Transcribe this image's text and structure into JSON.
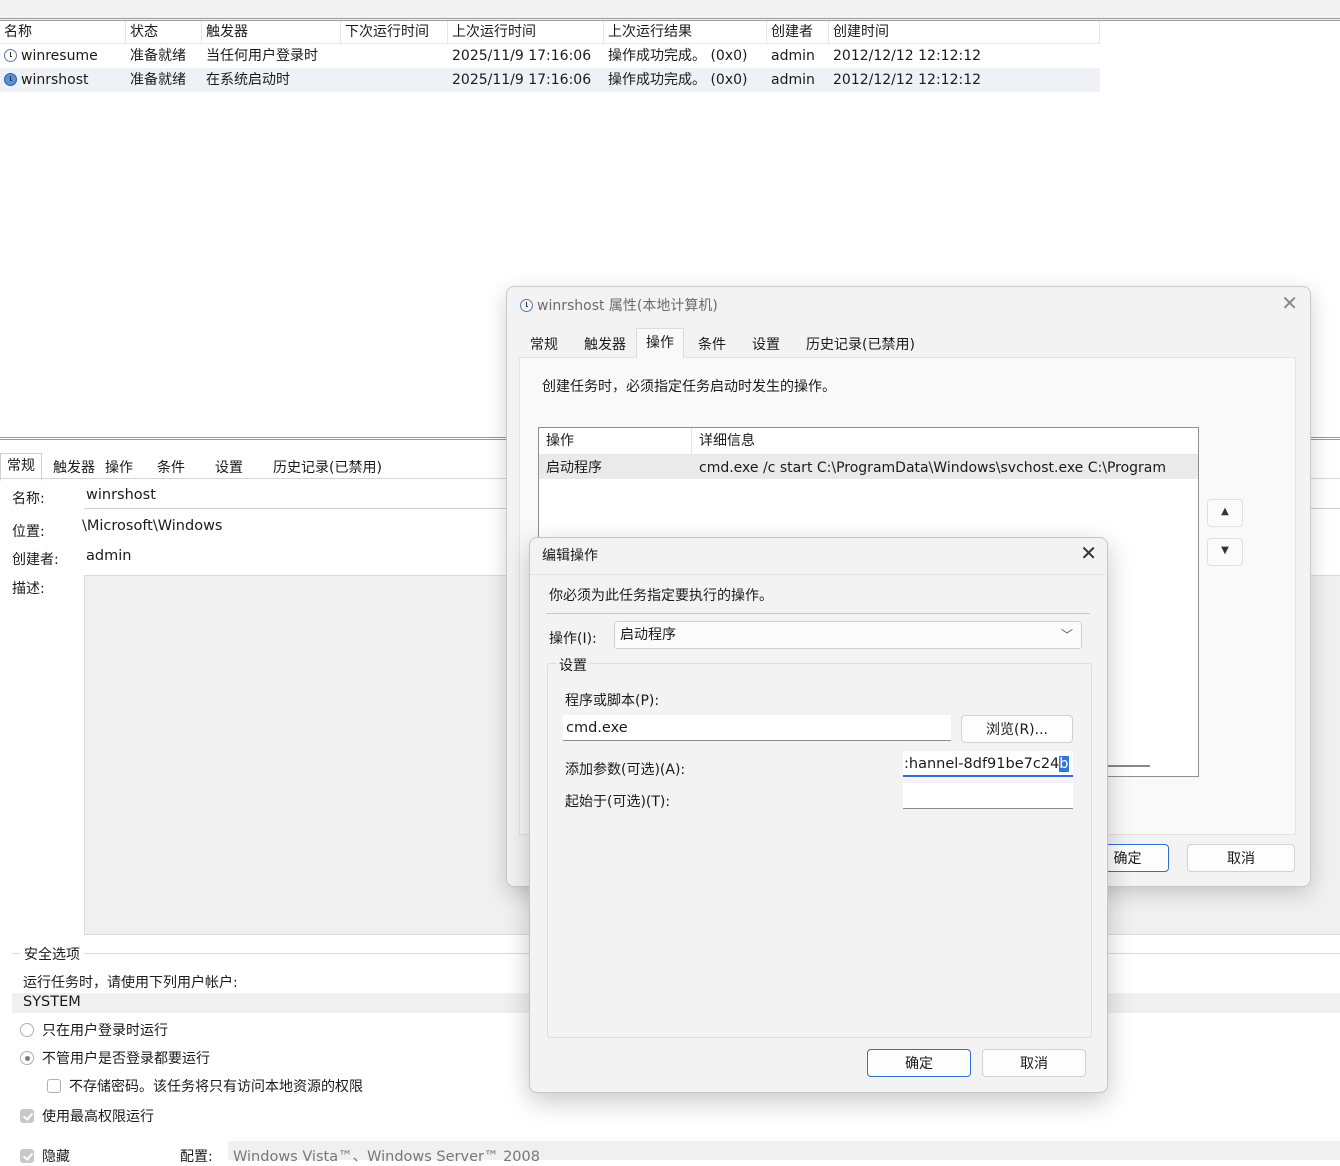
{
  "task_list": {
    "columns": [
      "名称",
      "状态",
      "触发器",
      "下次运行时间",
      "上次运行时间",
      "上次运行结果",
      "创建者",
      "创建时间"
    ],
    "rows": [
      {
        "name": "winresume",
        "status": "准备就绪",
        "trigger": "当任何用户登录时",
        "next_run": "",
        "last_run": "2025/11/9 17:16:06",
        "last_result": "操作成功完成。 (0x0)",
        "author": "admin",
        "created": "2012/12/12 12:12:12",
        "icon": "clock-icon"
      },
      {
        "name": "winrshost",
        "status": "准备就绪",
        "trigger": "在系统启动时",
        "next_run": "",
        "last_run": "2025/11/9 17:16:06",
        "last_result": "操作成功完成。 (0x0)",
        "author": "admin",
        "created": "2012/12/12 12:12:12",
        "icon": "clock-icon"
      }
    ]
  },
  "lower_panel": {
    "tabs": [
      "常规",
      "触发器",
      "操作",
      "条件",
      "设置",
      "历史记录(已禁用)"
    ],
    "name_label": "名称:",
    "name_value": "winrshost",
    "location_label": "位置:",
    "location_value": "\\Microsoft\\Windows",
    "author_label": "创建者:",
    "author_value": "admin",
    "desc_label": "描述:",
    "security_legend": "安全选项",
    "run_as_label": "运行任务时，请使用下列用户帐户:",
    "run_as_value": "SYSTEM",
    "opt_logged_on": "只在用户登录时运行",
    "opt_whether": "不管用户是否登录都要运行",
    "opt_no_password": "不存储密码。该任务将只有访问本地资源的权限",
    "opt_highest": "使用最高权限运行",
    "hidden_label": "隐藏",
    "config_label": "配置:",
    "config_value": "Windows Vista™、Windows Server™ 2008"
  },
  "properties_dialog": {
    "title": "winrshost 属性(本地计算机)",
    "tabs": [
      "常规",
      "触发器",
      "操作",
      "条件",
      "设置",
      "历史记录(已禁用)"
    ],
    "active_tab": "操作",
    "instruction": "创建任务时，必须指定任务启动时发生的操作。",
    "list_headers": [
      "操作",
      "详细信息"
    ],
    "list_rows": [
      {
        "action": "启动程序",
        "detail": "cmd.exe /c start C:\\ProgramData\\Windows\\svchost.exe C:\\Program"
      }
    ],
    "ok_label": "确定",
    "cancel_label": "取消"
  },
  "edit_dialog": {
    "title": "编辑操作",
    "subtitle": "你必须为此任务指定要执行的操作。",
    "action_label": "操作(I):",
    "action_value": "启动程序",
    "settings_legend": "设置",
    "program_label": "程序或脚本(P):",
    "program_value": "cmd.exe",
    "browse_label": "浏览(R)...",
    "args_label": "添加参数(可选)(A):",
    "args_value": ":hannel-8df91be7c24",
    "args_selected_char": "b",
    "start_in_label": "起始于(可选)(T):",
    "start_in_value": "",
    "ok_label": "确定",
    "cancel_label": "取消"
  }
}
